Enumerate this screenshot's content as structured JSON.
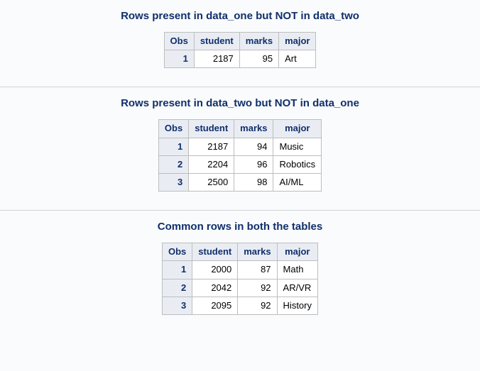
{
  "columns": {
    "obs": "Obs",
    "student": "student",
    "marks": "marks",
    "major": "major"
  },
  "sections": [
    {
      "title": "Rows present in data_one but NOT in data_two",
      "rows": [
        {
          "obs": "1",
          "student": "2187",
          "marks": "95",
          "major": "Art"
        }
      ]
    },
    {
      "title": "Rows present in data_two but NOT in data_one",
      "rows": [
        {
          "obs": "1",
          "student": "2187",
          "marks": "94",
          "major": "Music"
        },
        {
          "obs": "2",
          "student": "2204",
          "marks": "96",
          "major": "Robotics"
        },
        {
          "obs": "3",
          "student": "2500",
          "marks": "98",
          "major": "AI/ML"
        }
      ]
    },
    {
      "title": "Common rows in both the tables",
      "rows": [
        {
          "obs": "1",
          "student": "2000",
          "marks": "87",
          "major": "Math"
        },
        {
          "obs": "2",
          "student": "2042",
          "marks": "92",
          "major": "AR/VR"
        },
        {
          "obs": "3",
          "student": "2095",
          "marks": "92",
          "major": "History"
        }
      ]
    }
  ],
  "chart_data": [
    {
      "type": "table",
      "title": "Rows present in data_one but NOT in data_two",
      "columns": [
        "Obs",
        "student",
        "marks",
        "major"
      ],
      "rows": [
        [
          1,
          2187,
          95,
          "Art"
        ]
      ]
    },
    {
      "type": "table",
      "title": "Rows present in data_two but NOT in data_one",
      "columns": [
        "Obs",
        "student",
        "marks",
        "major"
      ],
      "rows": [
        [
          1,
          2187,
          94,
          "Music"
        ],
        [
          2,
          2204,
          96,
          "Robotics"
        ],
        [
          3,
          2500,
          98,
          "AI/ML"
        ]
      ]
    },
    {
      "type": "table",
      "title": "Common rows in both the tables",
      "columns": [
        "Obs",
        "student",
        "marks",
        "major"
      ],
      "rows": [
        [
          1,
          2000,
          87,
          "Math"
        ],
        [
          2,
          2042,
          92,
          "AR/VR"
        ],
        [
          3,
          2095,
          92,
          "History"
        ]
      ]
    }
  ]
}
